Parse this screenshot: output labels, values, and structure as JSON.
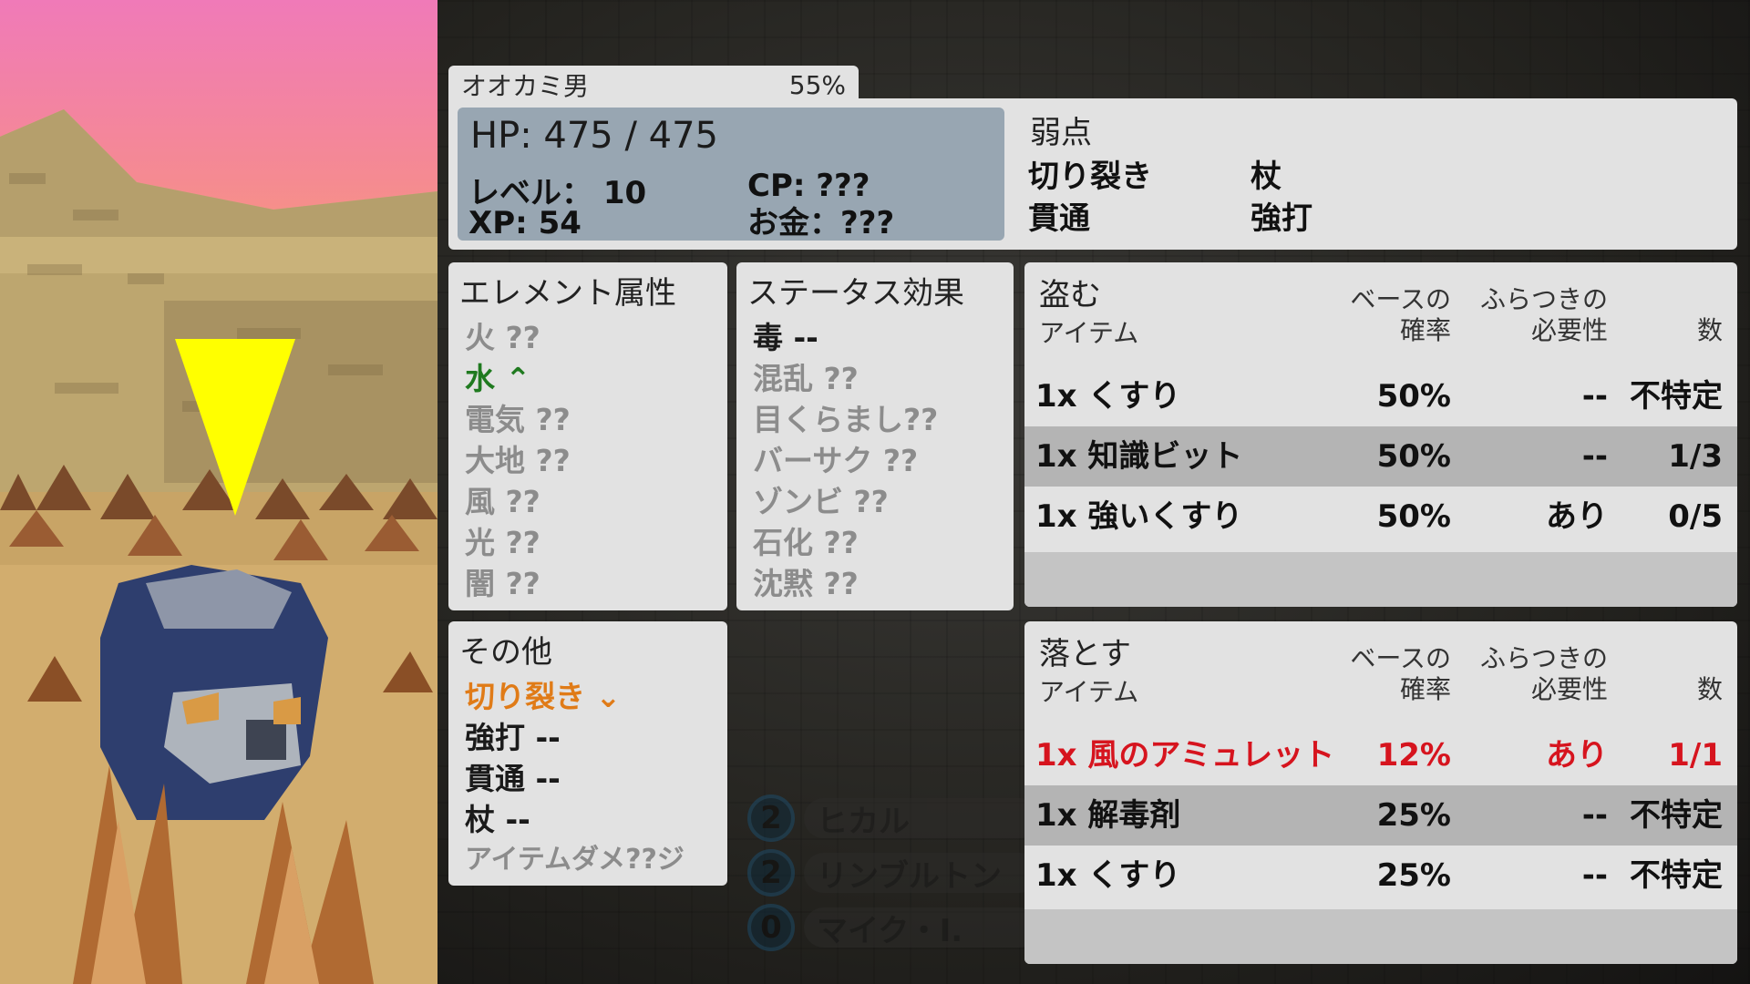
{
  "monster": {
    "name": "オオカミ男",
    "percent": "55%"
  },
  "stats": {
    "hp": "HP: 475 / 475",
    "level": "レベル： 10",
    "cp": "CP: ???",
    "xp": "XP: 54",
    "money": "お金：???"
  },
  "weakness": {
    "title": "弱点",
    "items": [
      "切り裂き",
      "杖",
      "貫通",
      "強打"
    ]
  },
  "elements": {
    "title": "エレメント属性",
    "items": [
      {
        "label": "火 ??",
        "tone": "gray"
      },
      {
        "label": "水 ⌃",
        "tone": "green"
      },
      {
        "label": "電気 ??",
        "tone": "gray"
      },
      {
        "label": "大地 ??",
        "tone": "gray"
      },
      {
        "label": "風 ??",
        "tone": "gray"
      },
      {
        "label": "光 ??",
        "tone": "gray"
      },
      {
        "label": "闇 ??",
        "tone": "gray"
      }
    ]
  },
  "status_effects": {
    "title": "ステータス効果",
    "items": [
      {
        "label": "毒 --",
        "tone": "dark"
      },
      {
        "label": "混乱 ??",
        "tone": "gray"
      },
      {
        "label": "目くらまし??",
        "tone": "gray"
      },
      {
        "label": "バーサク ??",
        "tone": "gray"
      },
      {
        "label": "ゾンビ ??",
        "tone": "gray"
      },
      {
        "label": "石化 ??",
        "tone": "gray"
      },
      {
        "label": "沈黙 ??",
        "tone": "gray"
      }
    ]
  },
  "other": {
    "title": "その他",
    "items": [
      {
        "label": "切り裂き ⌄",
        "tone": "orange"
      },
      {
        "label": "強打 --",
        "tone": "dark"
      },
      {
        "label": "貫通 --",
        "tone": "dark"
      },
      {
        "label": "杖 --",
        "tone": "dark"
      },
      {
        "label": "アイテムダメ??ジ",
        "tone": "gray"
      }
    ]
  },
  "steal": {
    "title": "盗む",
    "sub": "アイテム",
    "col_rate": [
      "ベースの",
      "確率"
    ],
    "col_need": [
      "ふらつきの",
      "必要性"
    ],
    "col_count": "数",
    "rows": [
      {
        "item": "1x くすり",
        "rate": "50%",
        "need": "--",
        "count": "不特定",
        "highlight": false
      },
      {
        "item": "1x 知識ビット",
        "rate": "50%",
        "need": "--",
        "count": "1/3",
        "highlight": false
      },
      {
        "item": "1x 強いくすり",
        "rate": "50%",
        "need": "あり",
        "count": "0/5",
        "highlight": false
      }
    ]
  },
  "drop": {
    "title": "落とす",
    "sub": "アイテム",
    "col_rate": [
      "ベースの",
      "確率"
    ],
    "col_need": [
      "ふらつきの",
      "必要性"
    ],
    "col_count": "数",
    "rows": [
      {
        "item": "1x 風のアミュレット",
        "rate": "12%",
        "need": "あり",
        "count": "1/1",
        "highlight": true
      },
      {
        "item": "1x 解毒剤",
        "rate": "25%",
        "need": "--",
        "count": "不特定",
        "highlight": false
      },
      {
        "item": "1x くすり",
        "rate": "25%",
        "need": "--",
        "count": "不特定",
        "highlight": false
      }
    ]
  },
  "party": [
    {
      "level": "2",
      "name": "ヒカル"
    },
    {
      "level": "2",
      "name": "リンブルトン"
    },
    {
      "level": "0",
      "name": "マイク・I."
    }
  ],
  "colors": {
    "panel": "#e2e2e2",
    "stats_box": "#98a6b2",
    "highlight_red": "#d6141e",
    "weak_orange": "#e07b17",
    "resist_green": "#1f7a1f",
    "target_marker": "#ffff00"
  }
}
